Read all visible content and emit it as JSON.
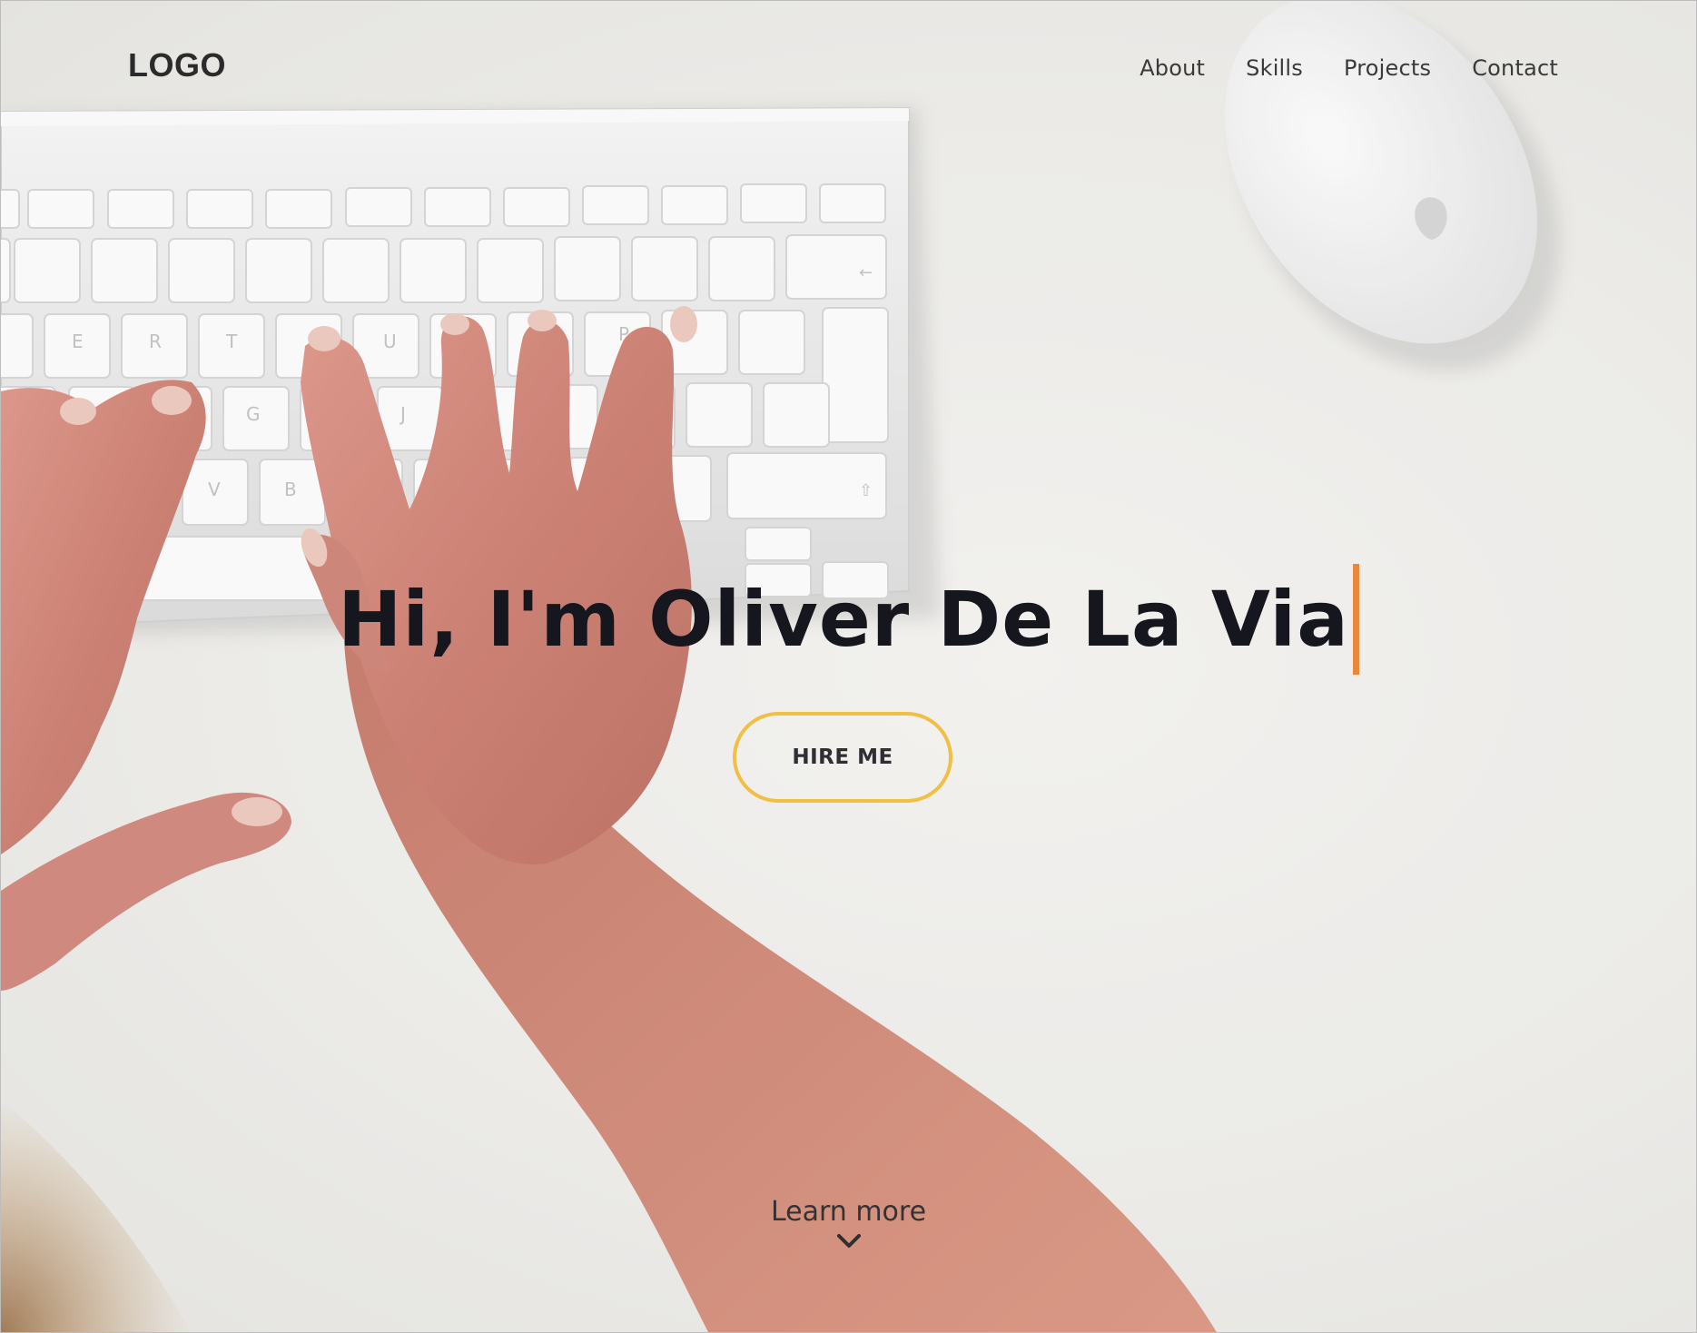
{
  "header": {
    "logo": "LOGO",
    "nav": [
      {
        "label": "About"
      },
      {
        "label": "Skills"
      },
      {
        "label": "Projects"
      },
      {
        "label": "Contact"
      }
    ]
  },
  "hero": {
    "headline": "Hi, I'm Oliver De La Via",
    "cta_label": "HIRE ME",
    "learn_more": "Learn more",
    "learn_more_icon": "chevron-down-icon",
    "background": "photo of hands typing on white keyboard with mouse on white desk"
  },
  "colors": {
    "cta_border": "#f0bf45",
    "cursor": "#e9873a",
    "headline": "#16161f"
  }
}
